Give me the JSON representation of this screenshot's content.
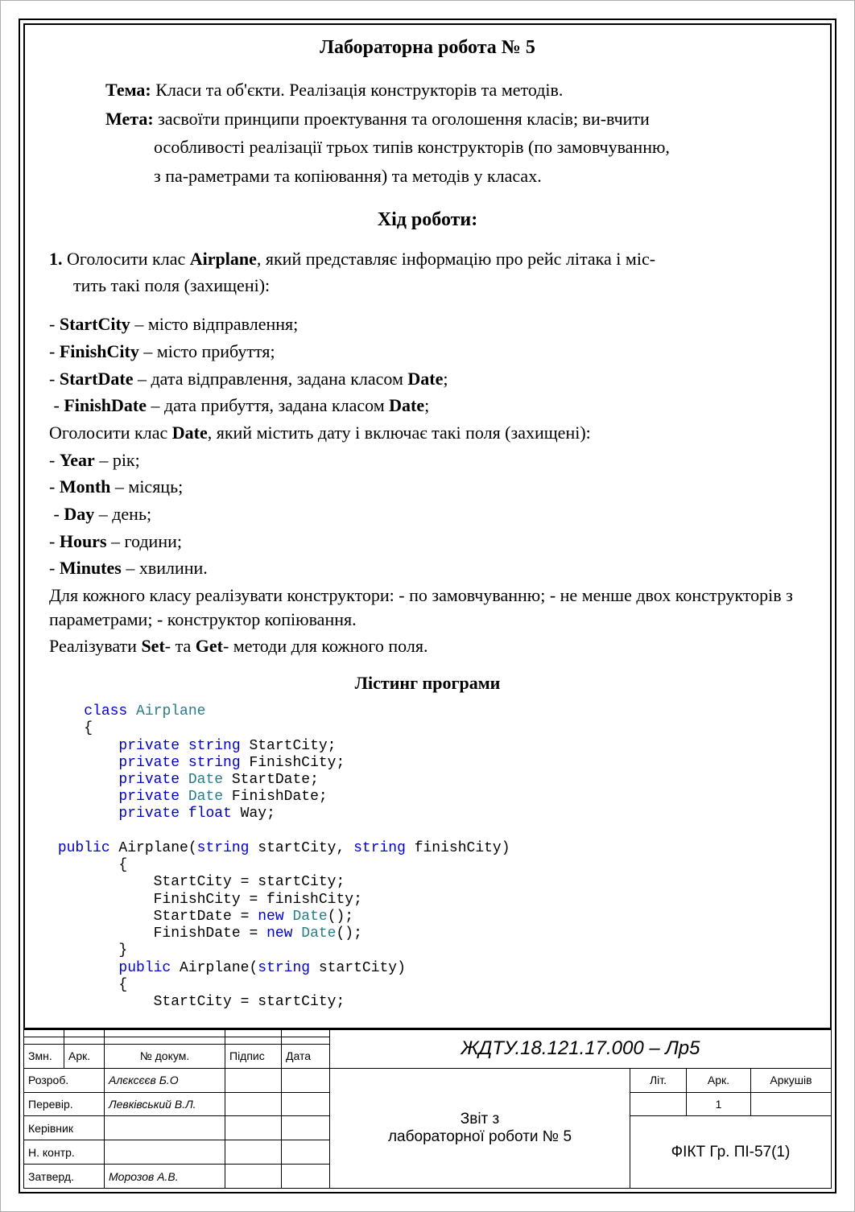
{
  "title": "Лабораторна робота  № 5",
  "tema_label": "Тема:",
  "tema_text": " Класи та об'єкти. Реалізація конструкторів та методів.",
  "meta_label": "Мета:",
  "meta_text_line1": " засвоїти принципи проектування та оголошення класів; ви-вчити",
  "meta_text_line2": "особливості реалізації трьох типів конструкторів (по замовчуванню,",
  "meta_text_line3": "з па-раметрами та копіювання) та методів у класах.",
  "progress_heading": "Хід роботи:",
  "task_num": "1.",
  "task_text_a": " Оголосити клас ",
  "task_class1": "Airplane",
  "task_text_b": ", який представляє інформацію про рейс літака і міс-",
  "task_text_c": "тить такі поля (захищені):",
  "f1_name": "StartCity",
  "f1_desc": " – місто відправлення;",
  "f2_name": "FinishCity",
  "f2_desc": " – місто прибуття;",
  "f3_name": "StartDate",
  "f3_desc": " – дата відправлення, задана класом ",
  "f4_name": "FinishDate",
  "f4_desc": " – дата прибуття, задана класом ",
  "date_class": "Date",
  "semicolon": ";",
  "date_sentence_a": " Оголосити клас ",
  "date_sentence_b": ", який містить дату і включає такі поля (захищені):",
  "d1_name": "Year",
  "d1_desc": " – рік;",
  "d2_name": "Month",
  "d2_desc": " – місяць;",
  "d3_name": "Day",
  "d3_desc": " – день;",
  "d4_name": "Hours",
  "d4_desc": " – години;",
  "d5_name": "Minutes",
  "d5_desc": " – хвилини.",
  "ctor_para1": "Для кожного класу реалізувати конструктори: - по замовчуванню; - не менше двох конструкторів з параметрами; - конструктор копіювання.",
  "ctor_para2a": "Реалізувати ",
  "ctor_set": "Set",
  "ctor_para2b": "- та ",
  "ctor_get": "Get",
  "ctor_para2c": "- методи для кожного поля.",
  "listing_heading": "Лістинг програми",
  "code": {
    "l01_kw": "class",
    "l01_ty": " Airplane",
    "l02": "{",
    "l03_kw": "private ",
    "l03_ty": "string",
    "l03_nm": " StartCity;",
    "l04_kw": "private ",
    "l04_ty": "string",
    "l04_nm": " FinishCity;",
    "l05_kw": "private ",
    "l05_ty": "Date",
    "l05_nm": " StartDate;",
    "l06_kw": "private ",
    "l06_ty": "Date",
    "l06_nm": " FinishDate;",
    "l07_kw": "private ",
    "l07_ty": "float",
    "l07_nm": " Way;",
    "l08_kw": "public",
    "l08_nm_a": " Airplane(",
    "l08_ty1": "string",
    "l08_nm_b": " startCity, ",
    "l08_ty2": "string",
    "l08_nm_c": " finishCity)",
    "l09": "{",
    "l10": "StartCity = startCity;",
    "l11": "FinishCity = finishCity;",
    "l12a": "StartDate = ",
    "l12_kw": "new ",
    "l12_ty": "Date",
    "l12b": "();",
    "l13a": "FinishDate = ",
    "l13_kw": "new ",
    "l13_ty": "Date",
    "l13b": "();",
    "l14": "}",
    "l15_kw": "public",
    "l15_nm_a": " Airplane(",
    "l15_ty": "string",
    "l15_nm_b": " startCity)",
    "l16": "{",
    "l17": "StartCity = startCity;"
  },
  "stamp": {
    "doc_code": "ЖДТУ.18.121.17.000 – Лр5",
    "h_zmn": "Змн.",
    "h_ark": "Арк.",
    "h_ndok": "№ докум.",
    "h_pidpys": "Підпис",
    "h_data": "Дата",
    "r1_role": "Розроб.",
    "r1_name": "Алєксєєв Б.О",
    "r2_role": "Перевір.",
    "r2_name": "Левківський В.Л.",
    "r3_role": "Керівник",
    "r4_role": "Н. контр.",
    "r5_role": "Затверд.",
    "r5_name": "Морозов А.В.",
    "lit": "Літ.",
    "ark2": "Арк.",
    "arkushiv": "Аркушів",
    "pagenum": "1",
    "report_line1": "Звіт з",
    "report_line2": "лабораторної роботи № 5",
    "group": "ФІКТ Гр. ПІ-57(1)"
  }
}
